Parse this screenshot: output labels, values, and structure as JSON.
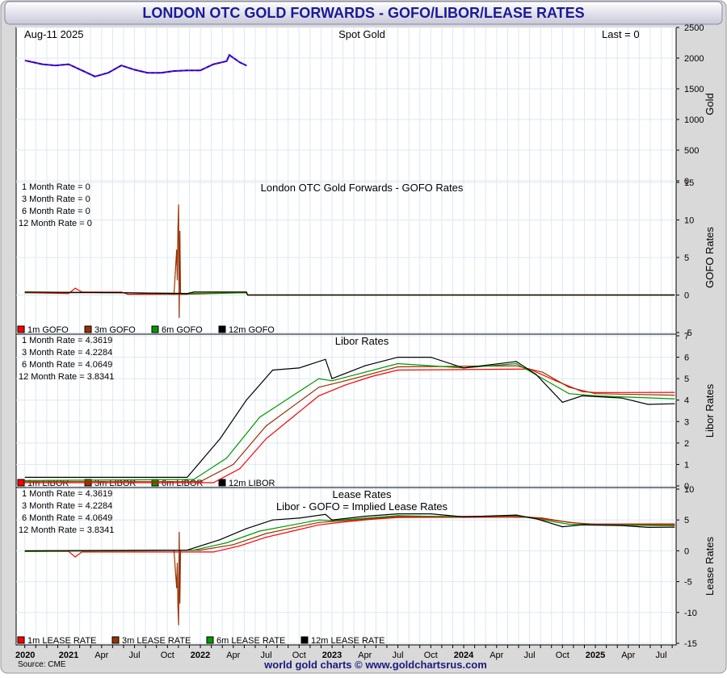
{
  "title": "LONDON OTC GOLD FORWARDS - GOFO/LIBOR/LEASE RATES",
  "source": "Source: CME",
  "footer": "world gold charts © www.goldchartsrus.com",
  "colors": {
    "1m": "#ff0000",
    "3m": "#993300",
    "6m": "#009900",
    "12m": "#000000",
    "gold_up": "#0000ff",
    "gold_down": "#ff0000",
    "title": "#1a1a99"
  },
  "x_ticks": [
    {
      "label": "2020",
      "t": 2020.67,
      "bold": true
    },
    {
      "label": "2021",
      "t": 2021.0,
      "bold": true
    },
    {
      "label": "Apr",
      "t": 2021.25
    },
    {
      "label": "Jul",
      "t": 2021.5
    },
    {
      "label": "Oct",
      "t": 2021.75
    },
    {
      "label": "2022",
      "t": 2022.0,
      "bold": true
    },
    {
      "label": "Apr",
      "t": 2022.25
    },
    {
      "label": "Jul",
      "t": 2022.5
    },
    {
      "label": "Oct",
      "t": 2022.75
    },
    {
      "label": "2023",
      "t": 2023.0,
      "bold": true
    },
    {
      "label": "Apr",
      "t": 2023.25
    },
    {
      "label": "Jul",
      "t": 2023.5
    },
    {
      "label": "Oct",
      "t": 2023.75
    },
    {
      "label": "2024",
      "t": 2024.0,
      "bold": true
    },
    {
      "label": "Apr",
      "t": 2024.25
    },
    {
      "label": "Jul",
      "t": 2024.5
    },
    {
      "label": "Oct",
      "t": 2024.75
    },
    {
      "label": "2025",
      "t": 2025.0,
      "bold": true
    },
    {
      "label": "Apr",
      "t": 2025.25
    },
    {
      "label": "Jul",
      "t": 2025.5
    }
  ],
  "chart_data": [
    {
      "type": "line",
      "title": "Spot Gold",
      "date": "Aug-11 2025",
      "last": "Last = 0",
      "ylabel": "Gold",
      "ylim": [
        0,
        2500
      ],
      "yticks": [
        0,
        500,
        1000,
        1500,
        2000,
        2500
      ],
      "series": [
        {
          "name": "Gold",
          "color": "#0000ff",
          "points": [
            [
              2020.67,
              1960
            ],
            [
              2020.8,
              1900
            ],
            [
              2020.9,
              1880
            ],
            [
              2021.0,
              1900
            ],
            [
              2021.1,
              1800
            ],
            [
              2021.2,
              1700
            ],
            [
              2021.3,
              1760
            ],
            [
              2021.4,
              1880
            ],
            [
              2021.5,
              1810
            ],
            [
              2021.6,
              1760
            ],
            [
              2021.7,
              1760
            ],
            [
              2021.8,
              1790
            ],
            [
              2021.9,
              1800
            ],
            [
              2022.0,
              1800
            ],
            [
              2022.1,
              1900
            ],
            [
              2022.2,
              1950
            ],
            [
              2022.22,
              2050
            ],
            [
              2022.3,
              1930
            ],
            [
              2022.35,
              1880
            ]
          ]
        }
      ]
    },
    {
      "type": "line",
      "title": "London OTC Gold Forwards - GOFO Rates",
      "ylabel": "GOFO Rates",
      "ylim": [
        -5,
        15
      ],
      "yticks": [
        -5,
        0,
        5,
        10,
        15
      ],
      "readouts": [
        "1 Month Rate = 0",
        "3 Month Rate = 0",
        "6 Month Rate = 0",
        "12 Month Rate = 0"
      ],
      "legend": [
        "1m GOFO",
        "3m GOFO",
        "6m GOFO",
        "12m GOFO"
      ],
      "series": [
        {
          "name": "1m GOFO",
          "points": [
            [
              2020.67,
              0.3
            ],
            [
              2021.0,
              0.2
            ],
            [
              2021.05,
              0.9
            ],
            [
              2021.1,
              0.4
            ],
            [
              2021.4,
              0.4
            ],
            [
              2021.45,
              0.1
            ],
            [
              2021.9,
              0.1
            ],
            [
              2021.95,
              0.4
            ],
            [
              2022.35,
              0.4
            ],
            [
              2022.36,
              0
            ],
            [
              2025.6,
              0
            ]
          ]
        },
        {
          "name": "3m GOFO",
          "points": [
            [
              2020.67,
              0.3
            ],
            [
              2021.4,
              0.3
            ],
            [
              2021.8,
              0.1
            ],
            [
              2021.81,
              3
            ],
            [
              2021.82,
              6
            ],
            [
              2021.825,
              2
            ],
            [
              2021.83,
              9
            ],
            [
              2021.835,
              12
            ],
            [
              2021.84,
              -3
            ],
            [
              2021.845,
              8.5
            ],
            [
              2021.85,
              0.1
            ],
            [
              2022.35,
              0.3
            ],
            [
              2022.36,
              0
            ],
            [
              2025.6,
              0
            ]
          ]
        },
        {
          "name": "6m GOFO",
          "points": [
            [
              2020.67,
              0.4
            ],
            [
              2021.4,
              0.3
            ],
            [
              2021.9,
              0.2
            ],
            [
              2022.35,
              0.3
            ],
            [
              2022.36,
              0
            ],
            [
              2025.6,
              0
            ]
          ]
        },
        {
          "name": "12m GOFO",
          "points": [
            [
              2020.67,
              0.4
            ],
            [
              2021.4,
              0.3
            ],
            [
              2021.9,
              0.2
            ],
            [
              2021.95,
              0.4
            ],
            [
              2022.35,
              0.4
            ],
            [
              2022.36,
              0
            ],
            [
              2025.6,
              0
            ]
          ]
        }
      ]
    },
    {
      "type": "line",
      "title": "Libor Rates",
      "ylabel": "Libor Rates",
      "ylim": [
        0,
        7
      ],
      "yticks": [
        0,
        1,
        2,
        3,
        4,
        5,
        6,
        7
      ],
      "readouts": [
        "1 Month Rate = 4.3619",
        "3 Month Rate = 4.2284",
        "6 Month Rate = 4.0649",
        "12 Month Rate = 3.8341"
      ],
      "legend": [
        "1m LIBOR",
        "3m LIBOR",
        "6m LIBOR",
        "12m LIBOR"
      ],
      "series": [
        {
          "name": "1m LIBOR",
          "points": [
            [
              2020.67,
              0.15
            ],
            [
              2022.1,
              0.15
            ],
            [
              2022.3,
              0.8
            ],
            [
              2022.5,
              2.2
            ],
            [
              2022.7,
              3.2
            ],
            [
              2022.9,
              4.2
            ],
            [
              2023.1,
              4.7
            ],
            [
              2023.3,
              5.1
            ],
            [
              2023.5,
              5.4
            ],
            [
              2024.5,
              5.45
            ],
            [
              2024.7,
              4.9
            ],
            [
              2024.9,
              4.4
            ],
            [
              2025.0,
              4.35
            ],
            [
              2025.6,
              4.36
            ]
          ]
        },
        {
          "name": "3m LIBOR",
          "points": [
            [
              2020.67,
              0.2
            ],
            [
              2022.0,
              0.2
            ],
            [
              2022.25,
              1.0
            ],
            [
              2022.5,
              2.8
            ],
            [
              2022.7,
              3.7
            ],
            [
              2022.9,
              4.6
            ],
            [
              2023.1,
              4.9
            ],
            [
              2023.5,
              5.55
            ],
            [
              2024.4,
              5.6
            ],
            [
              2024.6,
              5.3
            ],
            [
              2024.8,
              4.6
            ],
            [
              2025.0,
              4.3
            ],
            [
              2025.6,
              4.23
            ]
          ]
        },
        {
          "name": "6m LIBOR",
          "points": [
            [
              2020.67,
              0.25
            ],
            [
              2021.95,
              0.3
            ],
            [
              2022.2,
              1.3
            ],
            [
              2022.45,
              3.2
            ],
            [
              2022.7,
              4.2
            ],
            [
              2022.9,
              5.0
            ],
            [
              2023.0,
              4.9
            ],
            [
              2023.5,
              5.7
            ],
            [
              2024.0,
              5.5
            ],
            [
              2024.4,
              5.7
            ],
            [
              2024.6,
              5.0
            ],
            [
              2024.8,
              4.3
            ],
            [
              2025.0,
              4.2
            ],
            [
              2025.6,
              4.06
            ]
          ]
        },
        {
          "name": "12m LIBOR",
          "points": [
            [
              2020.67,
              0.4
            ],
            [
              2021.9,
              0.4
            ],
            [
              2022.15,
              2.2
            ],
            [
              2022.35,
              4.0
            ],
            [
              2022.55,
              5.4
            ],
            [
              2022.75,
              5.5
            ],
            [
              2022.95,
              5.9
            ],
            [
              2023.0,
              5.0
            ],
            [
              2023.25,
              5.6
            ],
            [
              2023.5,
              6.0
            ],
            [
              2023.75,
              6.0
            ],
            [
              2024.0,
              5.5
            ],
            [
              2024.4,
              5.8
            ],
            [
              2024.55,
              5.2
            ],
            [
              2024.75,
              3.9
            ],
            [
              2024.9,
              4.2
            ],
            [
              2025.2,
              4.1
            ],
            [
              2025.4,
              3.8
            ],
            [
              2025.6,
              3.83
            ]
          ]
        }
      ]
    },
    {
      "type": "line",
      "title": "Lease Rates",
      "subtitle": "Libor - GOFO = Implied Lease Rates",
      "ylabel": "Lease Rates",
      "ylim": [
        -15,
        10
      ],
      "yticks": [
        -15,
        -10,
        -5,
        0,
        5,
        10
      ],
      "readouts": [
        "1 Month Rate = 4.3619",
        "3 Month Rate = 4.2284",
        "6 Month Rate = 4.0649",
        "12 Month Rate = 3.8341"
      ],
      "legend": [
        "1m LEASE RATE",
        "3m LEASE RATE",
        "6m LEASE RATE",
        "12m LEASE RATE"
      ],
      "series": [
        {
          "name": "1m LEASE RATE",
          "points": [
            [
              2020.67,
              -0.1
            ],
            [
              2021.0,
              -0.1
            ],
            [
              2021.05,
              -1
            ],
            [
              2021.1,
              -0.2
            ],
            [
              2022.1,
              -0.2
            ],
            [
              2022.3,
              0.8
            ],
            [
              2022.5,
              2.2
            ],
            [
              2022.7,
              3.2
            ],
            [
              2022.9,
              4.2
            ],
            [
              2023.1,
              4.7
            ],
            [
              2023.3,
              5.1
            ],
            [
              2023.5,
              5.4
            ],
            [
              2024.5,
              5.45
            ],
            [
              2024.7,
              4.9
            ],
            [
              2024.9,
              4.4
            ],
            [
              2025.0,
              4.35
            ],
            [
              2025.6,
              4.36
            ]
          ]
        },
        {
          "name": "3m LEASE RATE",
          "points": [
            [
              2020.67,
              -0.1
            ],
            [
              2021.8,
              0.1
            ],
            [
              2021.81,
              -3
            ],
            [
              2021.82,
              -6
            ],
            [
              2021.825,
              -2
            ],
            [
              2021.83,
              -9
            ],
            [
              2021.835,
              -12
            ],
            [
              2021.84,
              3
            ],
            [
              2021.845,
              -8.5
            ],
            [
              2021.85,
              0.1
            ],
            [
              2022.0,
              0.1
            ],
            [
              2022.25,
              1.0
            ],
            [
              2022.5,
              2.8
            ],
            [
              2022.7,
              3.7
            ],
            [
              2022.9,
              4.6
            ],
            [
              2023.1,
              4.9
            ],
            [
              2023.5,
              5.55
            ],
            [
              2024.4,
              5.6
            ],
            [
              2024.6,
              5.3
            ],
            [
              2024.8,
              4.6
            ],
            [
              2025.0,
              4.3
            ],
            [
              2025.6,
              4.23
            ]
          ]
        },
        {
          "name": "6m LEASE RATE",
          "points": [
            [
              2020.67,
              -0.1
            ],
            [
              2021.95,
              0.1
            ],
            [
              2022.2,
              1.3
            ],
            [
              2022.45,
              3.2
            ],
            [
              2022.7,
              4.2
            ],
            [
              2022.9,
              5.0
            ],
            [
              2023.0,
              4.9
            ],
            [
              2023.5,
              5.7
            ],
            [
              2024.0,
              5.5
            ],
            [
              2024.4,
              5.7
            ],
            [
              2024.6,
              5.0
            ],
            [
              2024.8,
              4.3
            ],
            [
              2025.0,
              4.2
            ],
            [
              2025.6,
              4.06
            ]
          ]
        },
        {
          "name": "12m LEASE RATE",
          "points": [
            [
              2020.67,
              0
            ],
            [
              2021.9,
              0.1
            ],
            [
              2022.15,
              1.8
            ],
            [
              2022.35,
              3.6
            ],
            [
              2022.55,
              5.0
            ],
            [
              2022.75,
              5.3
            ],
            [
              2022.95,
              5.9
            ],
            [
              2023.0,
              5.0
            ],
            [
              2023.25,
              5.6
            ],
            [
              2023.5,
              6.0
            ],
            [
              2023.75,
              6.0
            ],
            [
              2024.0,
              5.5
            ],
            [
              2024.4,
              5.8
            ],
            [
              2024.55,
              5.2
            ],
            [
              2024.75,
              3.9
            ],
            [
              2024.9,
              4.2
            ],
            [
              2025.2,
              4.1
            ],
            [
              2025.4,
              3.8
            ],
            [
              2025.6,
              3.83
            ]
          ]
        }
      ]
    }
  ]
}
